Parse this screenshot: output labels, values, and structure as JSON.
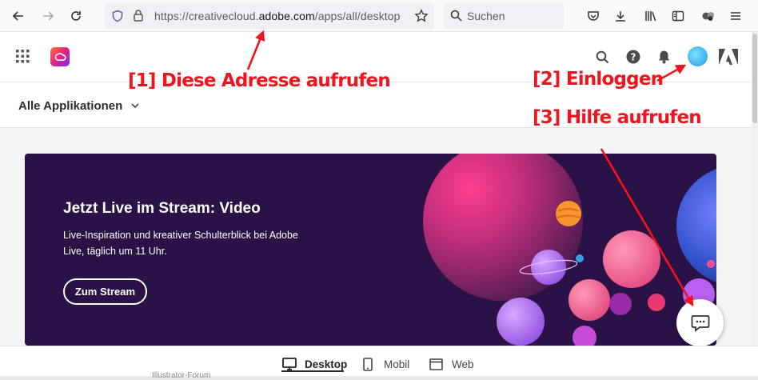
{
  "browser": {
    "url_prefix": "https://creativecloud.",
    "url_domain": "adobe.com",
    "url_suffix": "/apps/all/desktop",
    "search_placeholder": "Suchen"
  },
  "app": {
    "apps_menu_label": "Alle Applikationen"
  },
  "banner": {
    "title": "Jetzt Live im Stream: Video",
    "description": "Live-Inspiration und kreativer Schulterblick bei Adobe Live, täglich um 11 Uhr.",
    "button_label": "Zum Stream"
  },
  "bottom_tabs": [
    {
      "label": "Desktop",
      "icon": "monitor-icon",
      "active": true
    },
    {
      "label": "Mobil",
      "icon": "phone-icon",
      "active": false
    },
    {
      "label": "Web",
      "icon": "browser-window-icon",
      "active": false
    }
  ],
  "bottom_strip_text": "Illustrator-Forum",
  "annotations": {
    "step1": "[1] Diese Adresse aufrufen",
    "step2": "[2] Einloggen",
    "step3": "[3] Hilfe aufrufen"
  },
  "colors": {
    "annotation_red": "#f0141e",
    "banner_bg": "#2a1246",
    "avatar": "#2bb5e8"
  }
}
